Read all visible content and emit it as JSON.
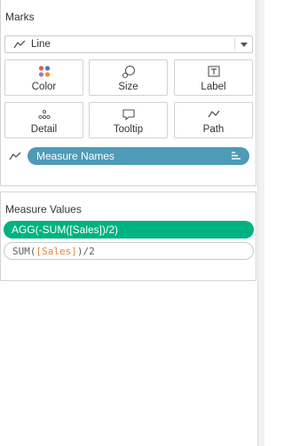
{
  "marks": {
    "title": "Marks",
    "mark_type": {
      "label": "Line",
      "icon": "line-icon"
    },
    "cards": [
      {
        "label": "Color",
        "icon": "color-dots-icon"
      },
      {
        "label": "Size",
        "icon": "size-circles-icon"
      },
      {
        "label": "Label",
        "icon": "label-t-icon"
      },
      {
        "label": "Detail",
        "icon": "detail-dots-icon"
      },
      {
        "label": "Tooltip",
        "icon": "tooltip-bubble-icon"
      },
      {
        "label": "Path",
        "icon": "path-line-icon"
      }
    ],
    "path_field": {
      "label": "Measure Names",
      "color": "#4d9bb6"
    }
  },
  "measure_values": {
    "title": "Measure Values",
    "items": [
      {
        "label": "AGG(-SUM([Sales])/2)",
        "color": "#00b281"
      },
      {
        "calc_fn": "SUM(",
        "calc_field": "[Sales]",
        "calc_rest": ")/2"
      }
    ]
  },
  "colors": {
    "color_dots": [
      "#e15759",
      "#4e79a7",
      "#af7aa1",
      "#f28e2b"
    ]
  }
}
